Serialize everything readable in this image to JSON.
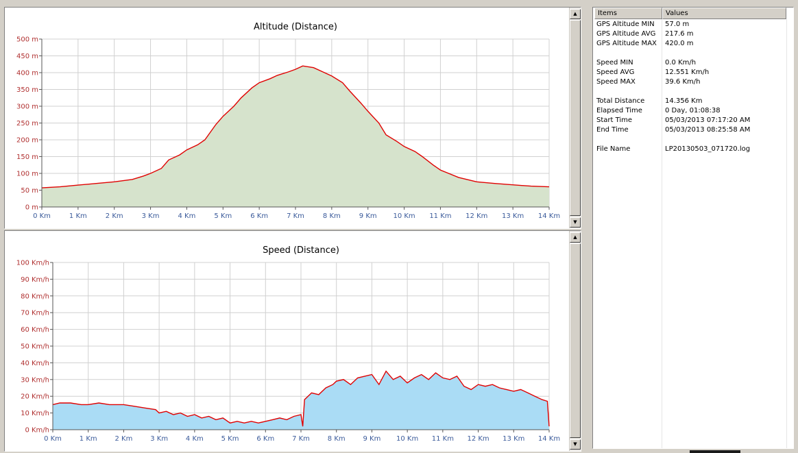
{
  "altitude_chart": {
    "title": "Altitude (Distance)",
    "y_ticks": [
      "500 m",
      "450 m",
      "400 m",
      "350 m",
      "300 m",
      "250 m",
      "200 m",
      "150 m",
      "100 m",
      "50 m",
      "0 m"
    ],
    "x_ticks": [
      "0 Km",
      "1 Km",
      "2 Km",
      "3 Km",
      "4 Km",
      "5 Km",
      "6 Km",
      "7 Km",
      "8 Km",
      "9 Km",
      "10 Km",
      "11 Km",
      "12 Km",
      "13 Km",
      "14 Km"
    ]
  },
  "speed_chart": {
    "title": "Speed (Distance)",
    "y_ticks": [
      "100 Km/h",
      "90 Km/h",
      "80 Km/h",
      "70 Km/h",
      "60 Km/h",
      "50 Km/h",
      "40 Km/h",
      "30 Km/h",
      "20 Km/h",
      "10 Km/h",
      "0 Km/h"
    ],
    "x_ticks": [
      "0 Km",
      "1 Km",
      "2 Km",
      "3 Km",
      "4 Km",
      "5 Km",
      "6 Km",
      "7 Km",
      "8 Km",
      "9 Km",
      "10 Km",
      "11 Km",
      "12 Km",
      "13 Km",
      "14 Km"
    ]
  },
  "chart_data": [
    {
      "type": "area",
      "title": "Altitude (Distance)",
      "xlabel": "",
      "ylabel": "",
      "xlim": [
        0,
        14
      ],
      "ylim": [
        0,
        500
      ],
      "grid": true,
      "colors": {
        "line": "#e00000",
        "fill": "#d6e3cc"
      },
      "x": [
        0,
        0.5,
        1,
        1.5,
        2,
        2.5,
        2.8,
        3,
        3.3,
        3.5,
        3.8,
        4,
        4.3,
        4.5,
        4.8,
        5,
        5.3,
        5.5,
        5.8,
        6,
        6.3,
        6.5,
        6.8,
        7,
        7.2,
        7.5,
        7.8,
        8,
        8.3,
        8.5,
        8.8,
        9,
        9.3,
        9.5,
        9.8,
        10,
        10.3,
        10.5,
        10.8,
        11,
        11.5,
        12,
        12.5,
        13,
        13.5,
        14
      ],
      "y": [
        57,
        60,
        65,
        70,
        75,
        82,
        92,
        100,
        115,
        140,
        155,
        170,
        185,
        200,
        245,
        270,
        300,
        325,
        355,
        370,
        382,
        392,
        402,
        410,
        420,
        415,
        400,
        390,
        370,
        345,
        310,
        285,
        250,
        215,
        195,
        180,
        165,
        150,
        125,
        110,
        88,
        75,
        70,
        66,
        62,
        60
      ]
    },
    {
      "type": "area",
      "title": "Speed (Distance)",
      "xlabel": "",
      "ylabel": "",
      "xlim": [
        0,
        14
      ],
      "ylim": [
        0,
        100
      ],
      "grid": true,
      "colors": {
        "line": "#e00000",
        "fill": "#aadcf5"
      },
      "x": [
        0,
        0.2,
        0.5,
        0.8,
        1,
        1.3,
        1.6,
        2,
        2.3,
        2.6,
        2.9,
        3,
        3.2,
        3.4,
        3.6,
        3.8,
        4,
        4.2,
        4.4,
        4.6,
        4.8,
        5,
        5.2,
        5.4,
        5.6,
        5.8,
        6,
        6.2,
        6.4,
        6.6,
        6.8,
        7,
        7.05,
        7.1,
        7.3,
        7.5,
        7.7,
        7.9,
        8,
        8.2,
        8.4,
        8.6,
        8.8,
        9,
        9.2,
        9.4,
        9.6,
        9.8,
        10,
        10.2,
        10.4,
        10.6,
        10.8,
        11,
        11.2,
        11.4,
        11.6,
        11.8,
        12,
        12.2,
        12.4,
        12.6,
        12.8,
        13,
        13.2,
        13.4,
        13.6,
        13.8,
        13.95,
        14
      ],
      "y": [
        15,
        16,
        16,
        15,
        15,
        16,
        15,
        15,
        14,
        13,
        12,
        10,
        11,
        9,
        10,
        8,
        9,
        7,
        8,
        6,
        7,
        4,
        5,
        4,
        5,
        4,
        5,
        6,
        7,
        6,
        8,
        9,
        2,
        18,
        22,
        21,
        25,
        27,
        29,
        30,
        27,
        31,
        32,
        33,
        27,
        35,
        30,
        32,
        28,
        31,
        33,
        30,
        34,
        31,
        30,
        32,
        26,
        24,
        27,
        26,
        27,
        25,
        24,
        23,
        24,
        22,
        20,
        18,
        17,
        2
      ]
    }
  ],
  "stats": {
    "header": {
      "items": "Items",
      "values": "Values"
    },
    "rows": [
      {
        "item": "GPS Altitude MIN",
        "value": "57.0 m"
      },
      {
        "item": "GPS Altitude AVG",
        "value": "217.6 m"
      },
      {
        "item": "GPS Altitude MAX",
        "value": "420.0 m"
      },
      {
        "item": "",
        "value": ""
      },
      {
        "item": "Speed MIN",
        "value": "0.0 Km/h"
      },
      {
        "item": "Speed AVG",
        "value": "12.551 Km/h"
      },
      {
        "item": "Speed MAX",
        "value": "39.6 Km/h"
      },
      {
        "item": "",
        "value": ""
      },
      {
        "item": "Total Distance",
        "value": "14.356 Km"
      },
      {
        "item": "Elapsed Time",
        "value": "0 Day, 01:08:38"
      },
      {
        "item": "Start Time",
        "value": "05/03/2013 07:17:20 AM"
      },
      {
        "item": "End Time",
        "value": "05/03/2013 08:25:58 AM"
      },
      {
        "item": "",
        "value": ""
      },
      {
        "item": "File Name",
        "value": "LP20130503_071720.log"
      }
    ]
  },
  "icons": {
    "scroll_up": "scroll-up-arrow-icon",
    "scroll_down": "scroll-down-arrow-icon"
  }
}
